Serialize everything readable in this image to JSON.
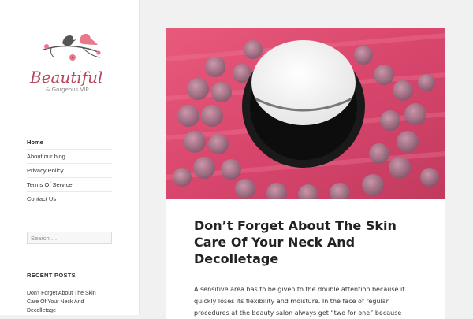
{
  "site": {
    "name": "Beautiful",
    "tagline": "& Gorgeous VIP"
  },
  "nav": {
    "items": [
      {
        "label": "Home",
        "active": true
      },
      {
        "label": "About our blog",
        "active": false
      },
      {
        "label": "Privacy Policy",
        "active": false
      },
      {
        "label": "Terms Of Service",
        "active": false
      },
      {
        "label": "Contact Us",
        "active": false
      }
    ]
  },
  "search": {
    "placeholder": "Search …"
  },
  "recent_posts": {
    "title": "RECENT POSTS",
    "items": [
      "Don't Forget About The Skin Care Of Your Neck And Decolletage"
    ]
  },
  "post": {
    "title": "Don’t Forget About The Skin Care Of Your Neck And Decolletage",
    "excerpt": "A sensitive area has to be given to the double attention because it quickly loses its flexibility and moisture. In the face of regular procedures at the beauty salon always get “two for one” because"
  },
  "colors": {
    "brand": "#b5475f",
    "accent_pink": "#e8798d",
    "bird_dark": "#555555",
    "background": "#f1f1f1"
  },
  "icons": [
    "birds-logo-icon"
  ]
}
